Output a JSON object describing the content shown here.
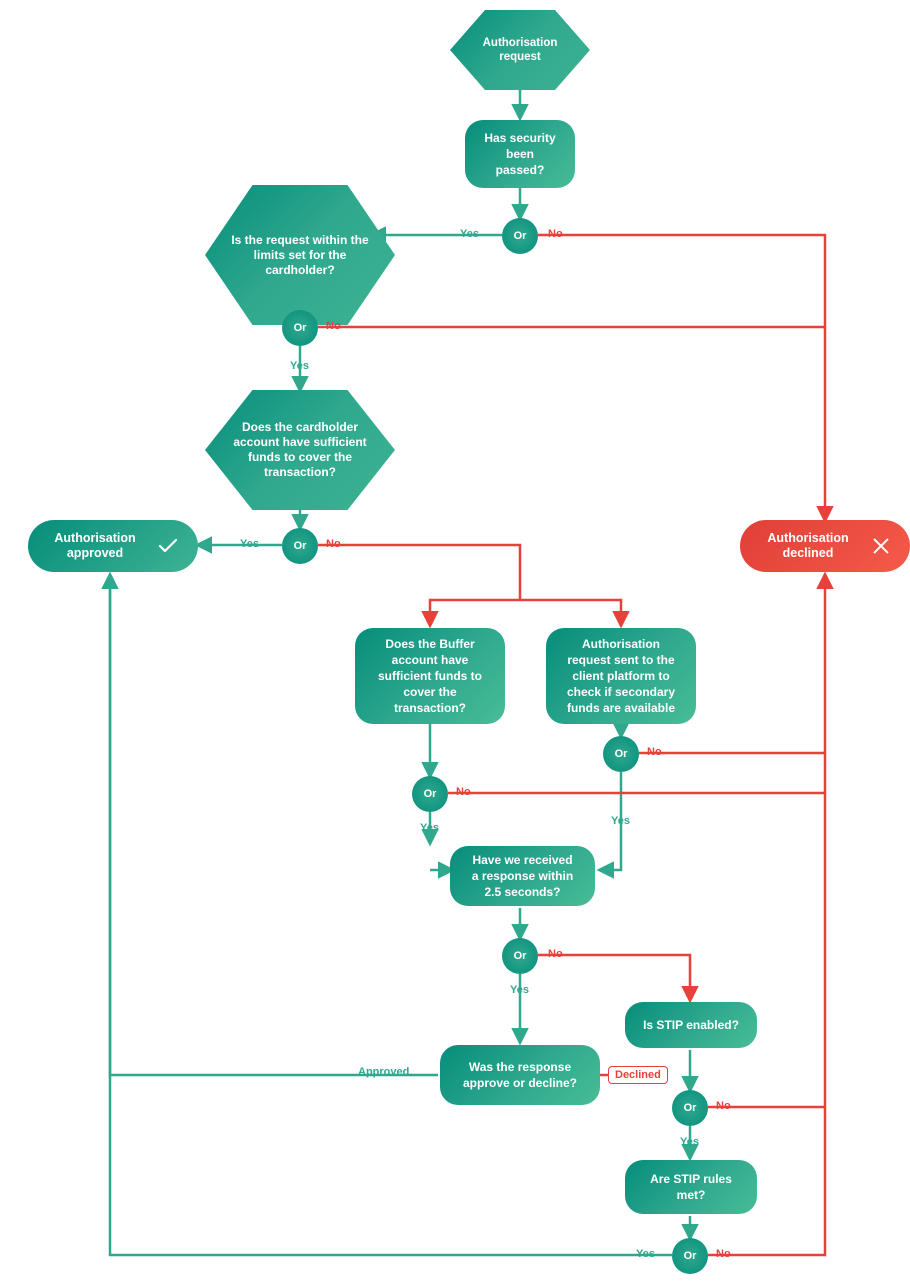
{
  "nodes": {
    "start": "Authorisation request",
    "security": "Has security been passed?",
    "limits": "Is the request within the limits set for the cardholder?",
    "funds": "Does the cardholder account have sufficient funds to cover the transaction?",
    "buffer": "Does the Buffer account have sufficient funds to cover the transaction?",
    "secondary": "Authorisation request sent to the client platform to check if secondary funds are available",
    "response25": "Have we received a response within 2.5 seconds?",
    "approve_or_decline": "Was the response approve or decline?",
    "stip_enabled": "Is STIP enabled?",
    "stip_rules": "Are STIP rules met?"
  },
  "or_label": "Or",
  "terminals": {
    "approved": "Authorisation approved",
    "declined": "Authorisation declined"
  },
  "edge_labels": {
    "yes": "Yes",
    "no": "No",
    "approved": "Approved",
    "declined": "Declined"
  }
}
